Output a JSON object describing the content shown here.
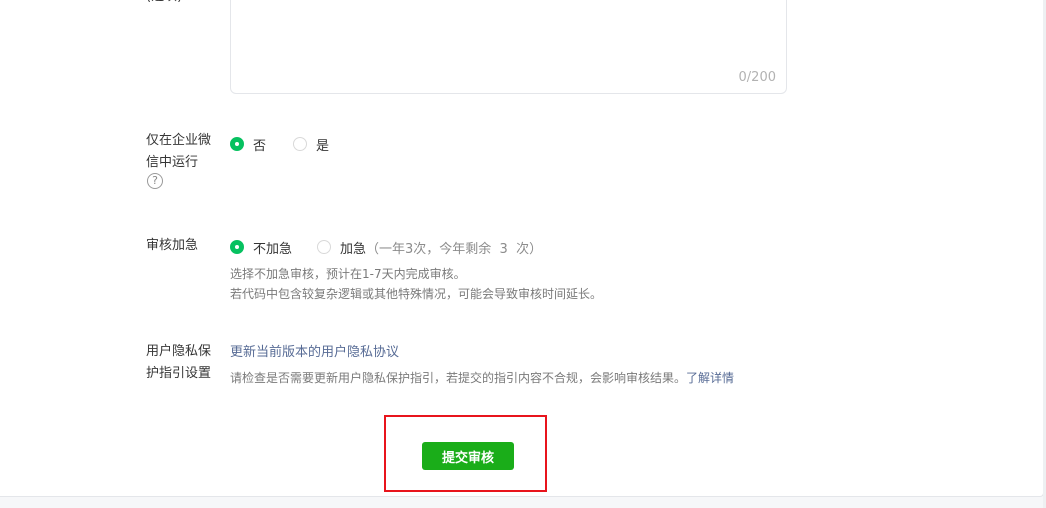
{
  "description_field": {
    "label_partial": "(选填)",
    "counter": "0/200"
  },
  "wework_only": {
    "label": "仅在企业微信中运行",
    "label_line1": "仅在企业微",
    "label_line2": "信中运行",
    "help_icon": "?",
    "options": [
      {
        "label": "否",
        "checked": true
      },
      {
        "label": "是",
        "checked": false
      }
    ]
  },
  "expedite": {
    "label": "审核加急",
    "options": [
      {
        "label": "不加急",
        "checked": true
      },
      {
        "label": "加急",
        "note": "（一年3次，今年剩余  3  次）",
        "checked": false
      }
    ],
    "desc_line1": "选择不加急审核，预计在1-7天内完成审核。",
    "desc_line2": "若代码中包含较复杂逻辑或其他特殊情况，可能会导致审核时间延长。"
  },
  "privacy": {
    "label_line1": "用户隐私保",
    "label_line2": "护指引设置",
    "link": "更新当前版本的用户隐私协议",
    "desc": "请检查是否需要更新用户隐私保护指引，若提交的指引内容不合规，会影响审核结果。",
    "desc_link": "了解详情"
  },
  "submit": {
    "label": "提交审核"
  },
  "colors": {
    "accent_green": "#07c160",
    "button_green": "#1aad19",
    "link_blue": "#576b95",
    "highlight_red": "#e8141c"
  }
}
